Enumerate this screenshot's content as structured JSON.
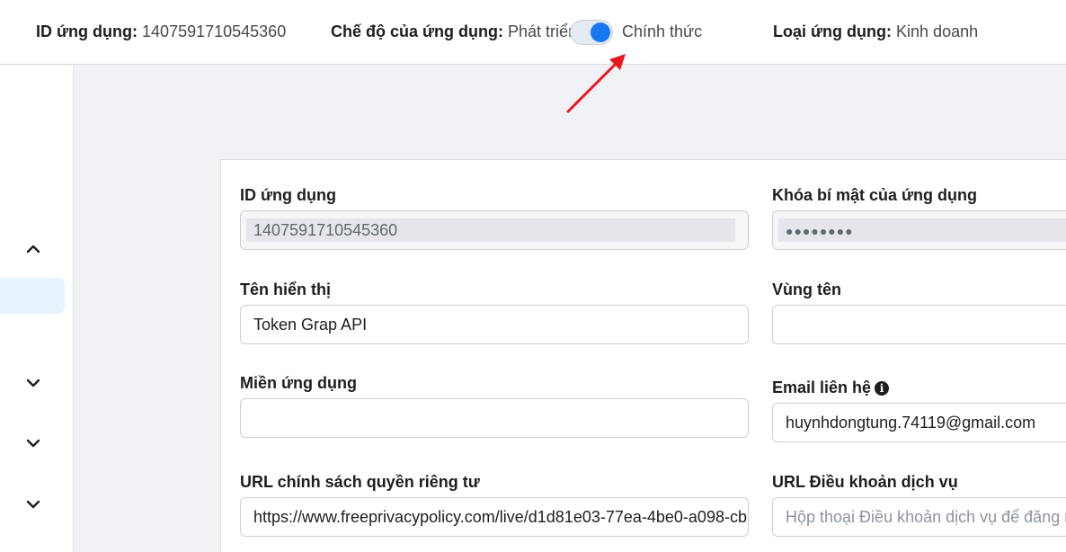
{
  "header": {
    "app_id_label": "ID ứng dụng:",
    "app_id_value": "1407591710545360",
    "mode_label": "Chế độ của ứng dụng:",
    "mode_dev": "Phát triển",
    "mode_live": "Chính thức",
    "type_label": "Loại ứng dụng:",
    "type_value": "Kinh doanh"
  },
  "form": {
    "app_id": {
      "label": "ID ứng dụng",
      "value": "1407591710545360"
    },
    "app_secret": {
      "label": "Khóa bí mật của ứng dụng",
      "value": "●●●●●●●●"
    },
    "display_name": {
      "label": "Tên hiển thị",
      "value": "Token Grap API"
    },
    "namespace": {
      "label": "Vùng tên",
      "value": ""
    },
    "app_domains": {
      "label": "Miền ứng dụng",
      "value": ""
    },
    "contact_email": {
      "label": "Email liên hệ",
      "value": "huynhdongtung.74119@gmail.com"
    },
    "privacy_url": {
      "label": "URL chính sách quyền riêng tư",
      "value": "https://www.freeprivacypolicy.com/live/d1d81e03-77ea-4be0-a098-cb"
    },
    "tos_url": {
      "label": "URL Điều khoản dịch vụ",
      "placeholder": "Hộp thoại Điều khoản dịch vụ để đăng nhập"
    }
  },
  "colors": {
    "accent": "#1877f2",
    "arrow": "#e8191c"
  }
}
